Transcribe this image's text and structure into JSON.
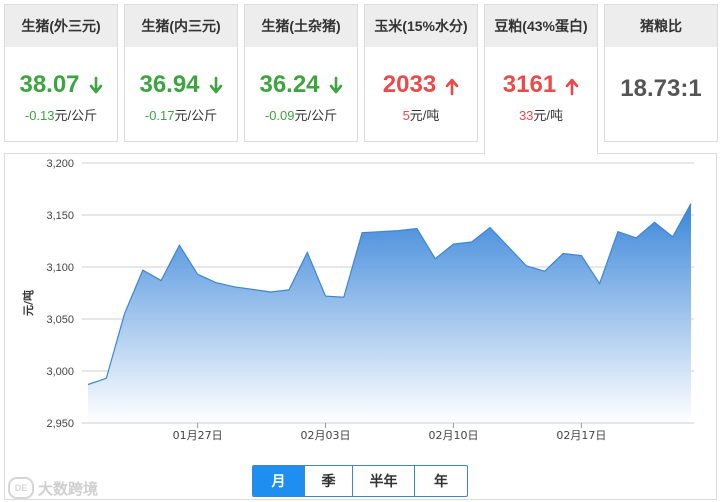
{
  "cards": [
    {
      "title": "生猪(外三元)",
      "value": "38.07",
      "direction": "down",
      "change": "-0.13",
      "unit": "元/公斤"
    },
    {
      "title": "生猪(内三元)",
      "value": "36.94",
      "direction": "down",
      "change": "-0.17",
      "unit": "元/公斤"
    },
    {
      "title": "生猪(土杂猪)",
      "value": "36.24",
      "direction": "down",
      "change": "-0.09",
      "unit": "元/公斤"
    },
    {
      "title": "玉米(15%水分)",
      "value": "2033",
      "direction": "up",
      "change": "5",
      "unit": "元/吨"
    },
    {
      "title": "豆粕(43%蛋白)",
      "value": "3161",
      "direction": "up",
      "change": "33",
      "unit": "元/吨",
      "active": true
    },
    {
      "title": "猪粮比",
      "value": "18.73:1",
      "direction": "none",
      "change": "",
      "unit": ""
    }
  ],
  "colors": {
    "down": "#3ea341",
    "up": "#e94b4b",
    "line": "#3d86cf",
    "accent": "#1e8ff0"
  },
  "period_tabs": [
    {
      "label": "月",
      "active": true
    },
    {
      "label": "季",
      "active": false
    },
    {
      "label": "半年",
      "active": false
    },
    {
      "label": "年",
      "active": false
    }
  ],
  "watermark": "大数跨境",
  "chart_data": {
    "type": "area",
    "title": "",
    "ylabel": "元/吨",
    "xlabel": "",
    "ylim": [
      2950,
      3200
    ],
    "yticks": [
      2950,
      3000,
      3050,
      3100,
      3150,
      3200
    ],
    "ytick_labels": [
      "2,950",
      "3,000",
      "3,050",
      "3,100",
      "3,150",
      "3,200"
    ],
    "x": [
      "01-21",
      "01-22",
      "01-23",
      "01-24",
      "01-25",
      "01-26",
      "01-27",
      "01-28",
      "01-29",
      "01-30",
      "01-31",
      "02-01",
      "02-02",
      "02-03",
      "02-04",
      "02-05",
      "02-06",
      "02-07",
      "02-08",
      "02-09",
      "02-10",
      "02-11",
      "02-12",
      "02-13",
      "02-14",
      "02-15",
      "02-16",
      "02-17",
      "02-18",
      "02-19",
      "02-20",
      "02-21",
      "02-22",
      "02-23"
    ],
    "xtick_labels": [
      {
        "date": "01-27",
        "label": "01月27日"
      },
      {
        "date": "02-03",
        "label": "02月03日"
      },
      {
        "date": "02-10",
        "label": "02月10日"
      },
      {
        "date": "02-17",
        "label": "02月17日"
      }
    ],
    "values": [
      2987,
      2993,
      3055,
      3097,
      3087,
      3121,
      3093,
      3085,
      3081,
      3076,
      3078,
      3114,
      3072,
      3071,
      3133,
      3135,
      3137,
      3108,
      3122,
      3124,
      3138,
      3101,
      3096,
      3113,
      3111,
      3084,
      3134,
      3128,
      3143,
      3129,
      3161
    ],
    "grid": true,
    "legend": "none"
  }
}
